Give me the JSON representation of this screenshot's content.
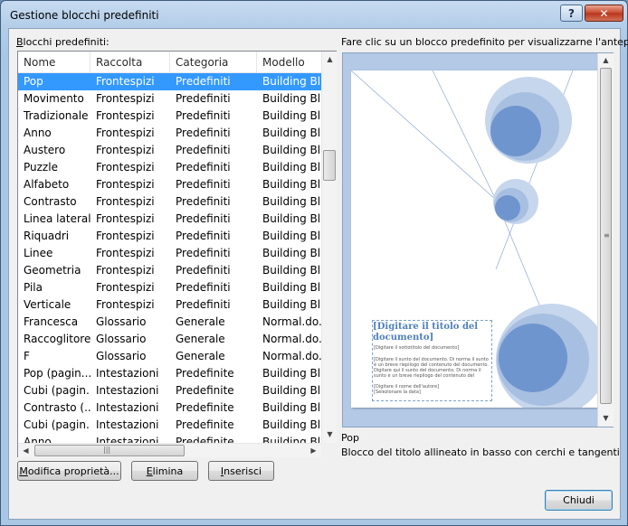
{
  "window": {
    "title": "Gestione blocchi predefiniti",
    "help_label": "?",
    "close_label": "✕"
  },
  "list": {
    "label_prefix": "B",
    "label_rest": "locchi predefiniti:",
    "columns": [
      "Nome",
      "Raccolta",
      "Categoria",
      "Modello"
    ],
    "rows": [
      [
        "Pop",
        "Frontespizi",
        "Predefiniti",
        "Building Bl..."
      ],
      [
        "Movimento",
        "Frontespizi",
        "Predefiniti",
        "Building Bl..."
      ],
      [
        "Tradizionale",
        "Frontespizi",
        "Predefiniti",
        "Building Bl..."
      ],
      [
        "Anno",
        "Frontespizi",
        "Predefiniti",
        "Building Bl..."
      ],
      [
        "Austero",
        "Frontespizi",
        "Predefiniti",
        "Building Bl..."
      ],
      [
        "Puzzle",
        "Frontespizi",
        "Predefiniti",
        "Building Bl..."
      ],
      [
        "Alfabeto",
        "Frontespizi",
        "Predefiniti",
        "Building Bl..."
      ],
      [
        "Contrasto",
        "Frontespizi",
        "Predefiniti",
        "Building Bl..."
      ],
      [
        "Linea laterale",
        "Frontespizi",
        "Predefiniti",
        "Building Bl..."
      ],
      [
        "Riquadri",
        "Frontespizi",
        "Predefiniti",
        "Building Bl..."
      ],
      [
        "Linee",
        "Frontespizi",
        "Predefiniti",
        "Building Bl..."
      ],
      [
        "Geometria",
        "Frontespizi",
        "Predefiniti",
        "Building Bl..."
      ],
      [
        "Pila",
        "Frontespizi",
        "Predefiniti",
        "Building Bl..."
      ],
      [
        "Verticale",
        "Frontespizi",
        "Predefiniti",
        "Building Bl..."
      ],
      [
        "Francesca",
        "Glossario",
        "Generale",
        "Normal.do..."
      ],
      [
        "Raccoglitore",
        "Glossario",
        "Generale",
        "Normal.do..."
      ],
      [
        "F",
        "Glossario",
        "Generale",
        "Normal.do..."
      ],
      [
        "Pop (pagin...",
        "Intestazioni",
        "Predefinite",
        "Building Bl..."
      ],
      [
        "Cubi (pagin...",
        "Intestazioni",
        "Predefinite",
        "Building Bl..."
      ],
      [
        "Contrasto (...",
        "Intestazioni",
        "Predefinite",
        "Building Bl..."
      ],
      [
        "Cubi (pagin...",
        "Intestazioni",
        "Predefinite",
        "Building Bl..."
      ],
      [
        "Anno",
        "Intestazioni",
        "Predefinite",
        "Building Bl..."
      ]
    ],
    "selected_index": 0
  },
  "buttons": {
    "modify_prefix": "M",
    "modify_rest": "odifica proprietà...",
    "delete_prefix": "E",
    "delete_rest": "limina",
    "insert_prefix": "I",
    "insert_rest": "nserisci",
    "close": "Chiudi"
  },
  "preview": {
    "label": "Fare clic su un blocco predefinito per visualizzarne l'anteprima",
    "doc_title": "[Digitare il titolo del documento]",
    "doc_subtitle": "[Digitare il sottotitolo del documento]",
    "doc_abstract": "[Digitare il sunto del documento. Di norma il sunto è un breve riepilogo del contenuto del documento. Digitare qui il sunto del documento. Di norma il sunto è un breve riepilogo del contenuto del documento.]",
    "doc_author": "[Digitare il nome dell'autore]",
    "doc_date": "[Selezionare la data]",
    "selected_name": "Pop",
    "selected_description": "Blocco del titolo allineato in basso con cerchi e tangenti"
  },
  "colors": {
    "selection": "#3399ff",
    "circle_light": "#c6d6ec",
    "circle_mid": "#a7bfe1",
    "circle_dark": "#6f95cf",
    "accent": "#4f81bd"
  }
}
